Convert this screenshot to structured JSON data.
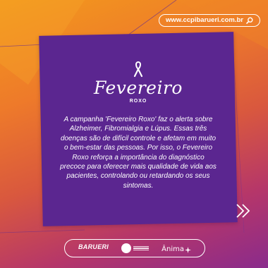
{
  "header": {
    "url_text": "www.ccpibarueri.com.br",
    "search_icon": "search-icon"
  },
  "card": {
    "ribbon_icon": "awareness-ribbon-icon",
    "title": "Fevereiro",
    "subtitle": "ROXO",
    "body": "A campanha 'Fevereiro Roxo' faz o alerta sobre Alzheimer, Fibromialgia e Lúpus. Essas três doenças são de difícil controle e afetam em muito o bem-estar das pessoas. Por isso, o Fevereiro Roxo reforça a importância do diagnóstico precoce para oferecer mais qualidade de vida aos pacientes, controlando ou retardando os seus sintomas."
  },
  "navigation": {
    "next_icon": "double-chevron-right-icon"
  },
  "footer": {
    "barueri_logo_text": "BARUERI",
    "anima_logo_text": "Ânima"
  },
  "colors": {
    "card_purple": "#5b2690",
    "gradient_orange": "#f39a1c",
    "gradient_magenta": "#b5366a",
    "text": "#ffffff"
  }
}
